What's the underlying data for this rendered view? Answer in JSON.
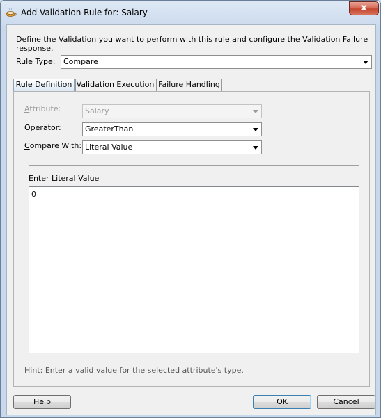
{
  "window": {
    "title": "Add Validation Rule for: Salary",
    "close_label": "x"
  },
  "description": "Define the Validation you want to perform with this rule and configure the Validation Failure response.",
  "rule_type": {
    "label_mnemonic": "R",
    "label_rest": "ule Type:",
    "value": "Compare"
  },
  "tabs": [
    {
      "label": "Rule Definition",
      "active": true
    },
    {
      "label": "Validation Execution",
      "active": false
    },
    {
      "label": "Failure Handling",
      "active": false
    }
  ],
  "rule_definition": {
    "attribute": {
      "label_mnemonic": "A",
      "label_rest": "ttribute:",
      "value": "Salary",
      "enabled": false
    },
    "operator": {
      "label_mnemonic": "O",
      "label_rest": "perator:",
      "value": "GreaterThan"
    },
    "compare_with": {
      "label_mnemonic": "C",
      "label_rest": "ompare With:",
      "value": "Literal Value"
    },
    "literal": {
      "label_mnemonic": "E",
      "label_rest": "nter Literal Value",
      "value": "0"
    },
    "hint": "Hint: Enter a valid value for the selected attribute's type."
  },
  "buttons": {
    "help_mnemonic": "H",
    "help_rest": "elp",
    "ok": "OK",
    "cancel": "Cancel"
  },
  "colors": {
    "title_bar": "#c9d9ec",
    "close_button": "#c4462e",
    "active_tab": "#dce8f5"
  }
}
